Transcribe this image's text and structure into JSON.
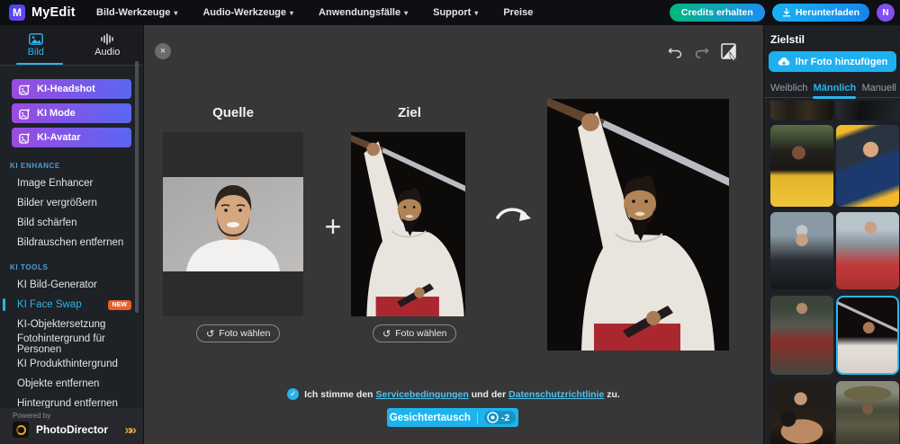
{
  "navbar": {
    "logo_letter": "M",
    "logo_text": "MyEdit",
    "menu": [
      {
        "label": "Bild-Werkzeuge",
        "has_dropdown": true
      },
      {
        "label": "Audio-Werkzeuge",
        "has_dropdown": true
      },
      {
        "label": "Anwendungsfälle",
        "has_dropdown": true
      },
      {
        "label": "Support",
        "has_dropdown": true
      },
      {
        "label": "Preise",
        "has_dropdown": false
      }
    ],
    "credits_button": "Credits erhalten",
    "download_button": "Herunterladen",
    "avatar_initial": "N"
  },
  "sidebar": {
    "tabs": [
      {
        "label": "Bild",
        "active": true
      },
      {
        "label": "Audio",
        "active": false
      }
    ],
    "gradient_buttons": [
      {
        "label": "KI-Headshot"
      },
      {
        "label": "KI Mode"
      },
      {
        "label": "KI-Avatar"
      }
    ],
    "sections": [
      {
        "label": "KI ENHANCE",
        "items": [
          {
            "label": "Image Enhancer"
          },
          {
            "label": "Bilder vergrößern"
          },
          {
            "label": "Bild schärfen"
          },
          {
            "label": "Bildrauschen entfernen"
          }
        ]
      },
      {
        "label": "KI Tools",
        "items": [
          {
            "label": "KI Bild-Generator"
          },
          {
            "label": "KI Face Swap",
            "active": true,
            "badge": "NEW"
          },
          {
            "label": "KI-Objektersetzung"
          },
          {
            "label": "Fotohintergrund für Personen"
          },
          {
            "label": "KI Produkthintergrund"
          },
          {
            "label": "Objekte entfernen"
          },
          {
            "label": "Hintergrund entfernen"
          }
        ]
      }
    ],
    "powered_by": "Powered by",
    "powered_by_app": "PhotoDirector"
  },
  "main": {
    "source_label": "Quelle",
    "target_label": "Ziel",
    "choose_photo_button": "Foto wählen",
    "terms": {
      "prefix": "Ich stimme den ",
      "link1": "Servicebedingungen",
      "middle": " und der ",
      "link2": "Datenschutzrichtlinie",
      "suffix": " zu.",
      "checked": true
    },
    "submit_button": "Gesichtertausch",
    "credit_cost": "-2"
  },
  "right_panel": {
    "title": "Zielstil",
    "upload_button": "Ihr Foto hinzufügen",
    "tabs": [
      {
        "label": "Weiblich",
        "active": false
      },
      {
        "label": "Männlich",
        "active": true
      },
      {
        "label": "Manuell",
        "active": false
      }
    ],
    "thumbnails": [
      {
        "name": "partial row left image"
      },
      {
        "name": "partial row right image"
      },
      {
        "name": "man in yellow convertible"
      },
      {
        "name": "man in blue suit in red car"
      },
      {
        "name": "gray-haired man in suit by car"
      },
      {
        "name": "man in gray suit leaning on red car"
      },
      {
        "name": "knight in armor"
      },
      {
        "name": "samurai with katana",
        "selected": true
      },
      {
        "name": "boxer with black gloves"
      },
      {
        "name": "soldier in camo uniform"
      }
    ]
  },
  "icons": {
    "chevron_down": "▾",
    "close": "×",
    "plus": "+",
    "reset": "↺",
    "check": "✓",
    "powered_chevrons": "»»"
  },
  "colors": {
    "accent_cyan": "#2ab5ea",
    "badge_orange": "#ee5e2a",
    "credits_gradient_start": "#00b87c",
    "credits_gradient_end": "#1e8ef0",
    "sidebar_button_gradient_start": "#9b4be0",
    "sidebar_button_gradient_end": "#5b66f2"
  }
}
